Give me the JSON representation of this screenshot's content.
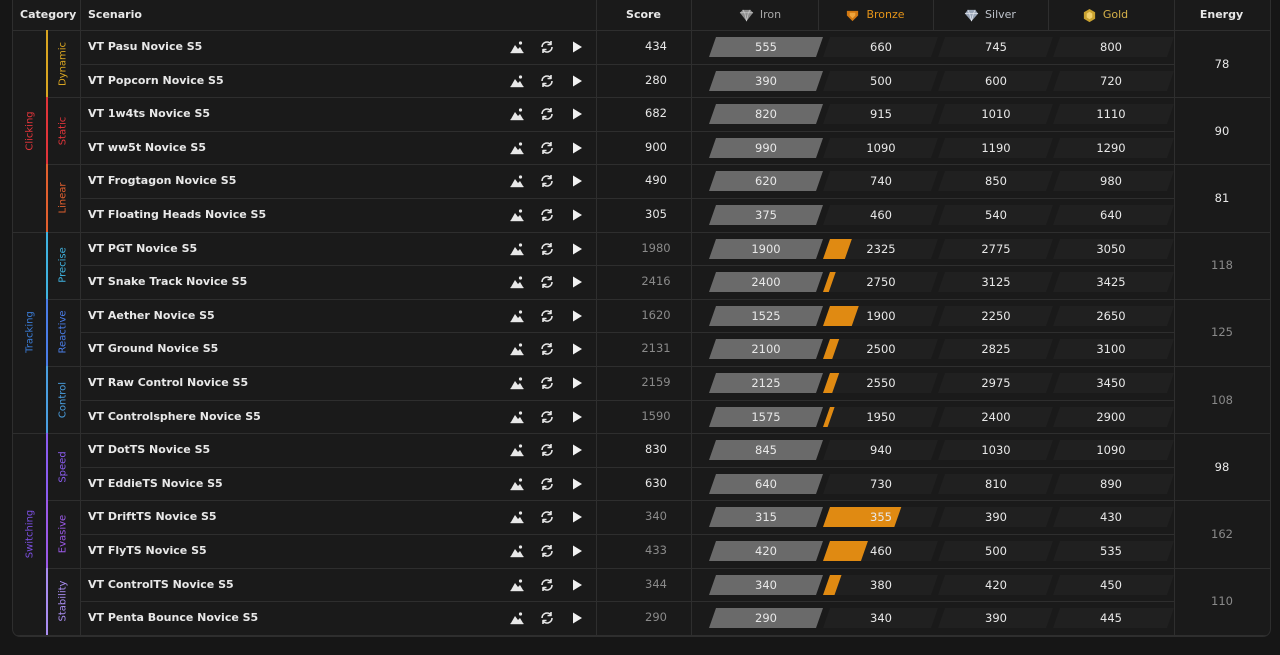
{
  "header": {
    "category": "Category",
    "scenario": "Scenario",
    "score": "Score",
    "iron": "Iron",
    "bronze": "Bronze",
    "silver": "Silver",
    "gold": "Gold",
    "energy": "Energy"
  },
  "colors": {
    "iron": "#a8a8a8",
    "bronze": "#e08a12",
    "silver": "#bfc4cc",
    "gold": "#d7b24a",
    "clicking": "#e0343a",
    "tracking": "#3a7bd5",
    "switching": "#7b4fe0"
  },
  "categories": [
    {
      "name": "Clicking",
      "color": "#e0343a",
      "rows": 6,
      "subs": [
        {
          "name": "Dynamic",
          "color": "#d9a521",
          "energy": "78",
          "energy_dim": false
        },
        {
          "name": "Static",
          "color": "#e0343a",
          "energy": "90",
          "energy_dim": false
        },
        {
          "name": "Linear",
          "color": "#e2602f",
          "energy": "81",
          "energy_dim": false
        }
      ]
    },
    {
      "name": "Tracking",
      "color": "#3a7bd5",
      "rows": 6,
      "subs": [
        {
          "name": "Precise",
          "color": "#3fb3e0",
          "energy": "118",
          "energy_dim": true
        },
        {
          "name": "Reactive",
          "color": "#4a7de8",
          "energy": "125",
          "energy_dim": true
        },
        {
          "name": "Control",
          "color": "#4a9fe0",
          "energy": "108",
          "energy_dim": true
        }
      ]
    },
    {
      "name": "Switching",
      "color": "#7b4fe0",
      "rows": 6,
      "subs": [
        {
          "name": "Speed",
          "color": "#8b5cf0",
          "energy": "98",
          "energy_dim": false
        },
        {
          "name": "Evasive",
          "color": "#9b59e8",
          "energy": "162",
          "energy_dim": true
        },
        {
          "name": "Stability",
          "color": "#a98df0",
          "energy": "110",
          "energy_dim": true
        }
      ]
    }
  ],
  "rows": [
    {
      "scenario": "VT Pasu Novice S5",
      "score": "434",
      "dim": false,
      "iron": "555",
      "bronze": "660",
      "silver": "745",
      "gold": "800",
      "progress": 0.0
    },
    {
      "scenario": "VT Popcorn Novice S5",
      "score": "280",
      "dim": false,
      "iron": "390",
      "bronze": "500",
      "silver": "600",
      "gold": "720",
      "progress": 0.0
    },
    {
      "scenario": "VT 1w4ts Novice S5",
      "score": "682",
      "dim": false,
      "iron": "820",
      "bronze": "915",
      "silver": "1010",
      "gold": "1110",
      "progress": 0.0
    },
    {
      "scenario": "VT ww5t Novice S5",
      "score": "900",
      "dim": false,
      "iron": "990",
      "bronze": "1090",
      "silver": "1190",
      "gold": "1290",
      "progress": 0.0
    },
    {
      "scenario": "VT Frogtagon Novice S5",
      "score": "490",
      "dim": false,
      "iron": "620",
      "bronze": "740",
      "silver": "850",
      "gold": "980",
      "progress": 0.0
    },
    {
      "scenario": "VT Floating Heads Novice S5",
      "score": "305",
      "dim": false,
      "iron": "375",
      "bronze": "460",
      "silver": "540",
      "gold": "640",
      "progress": 0.0
    },
    {
      "scenario": "VT PGT Novice S5",
      "score": "1980",
      "dim": true,
      "iron": "1900",
      "bronze": "2325",
      "silver": "2775",
      "gold": "3050",
      "progress": 0.19
    },
    {
      "scenario": "VT Snake Track Novice S5",
      "score": "2416",
      "dim": true,
      "iron": "2400",
      "bronze": "2750",
      "silver": "3125",
      "gold": "3425",
      "progress": 0.05
    },
    {
      "scenario": "VT Aether Novice S5",
      "score": "1620",
      "dim": true,
      "iron": "1525",
      "bronze": "1900",
      "silver": "2250",
      "gold": "2650",
      "progress": 0.25
    },
    {
      "scenario": "VT Ground Novice S5",
      "score": "2131",
      "dim": true,
      "iron": "2100",
      "bronze": "2500",
      "silver": "2825",
      "gold": "3100",
      "progress": 0.08
    },
    {
      "scenario": "VT Raw Control Novice S5",
      "score": "2159",
      "dim": true,
      "iron": "2125",
      "bronze": "2550",
      "silver": "2975",
      "gold": "3450",
      "progress": 0.08
    },
    {
      "scenario": "VT Controlsphere Novice S5",
      "score": "1590",
      "dim": true,
      "iron": "1575",
      "bronze": "1950",
      "silver": "2400",
      "gold": "2900",
      "progress": 0.04
    },
    {
      "scenario": "VT DotTS Novice S5",
      "score": "830",
      "dim": false,
      "iron": "845",
      "bronze": "940",
      "silver": "1030",
      "gold": "1090",
      "progress": 0.0
    },
    {
      "scenario": "VT EddieTS Novice S5",
      "score": "630",
      "dim": false,
      "iron": "640",
      "bronze": "730",
      "silver": "810",
      "gold": "890",
      "progress": 0.0
    },
    {
      "scenario": "VT DriftTS Novice S5",
      "score": "340",
      "dim": true,
      "iron": "315",
      "bronze": "355",
      "silver": "390",
      "gold": "430",
      "progress": 0.62
    },
    {
      "scenario": "VT FlyTS Novice S5",
      "score": "433",
      "dim": true,
      "iron": "420",
      "bronze": "460",
      "silver": "500",
      "gold": "535",
      "progress": 0.33
    },
    {
      "scenario": "VT ControlTS Novice S5",
      "score": "344",
      "dim": true,
      "iron": "340",
      "bronze": "380",
      "silver": "420",
      "gold": "450",
      "progress": 0.1
    },
    {
      "scenario": "VT Penta Bounce Novice S5",
      "score": "290",
      "dim": true,
      "iron": "290",
      "bronze": "340",
      "silver": "390",
      "gold": "445",
      "progress": 0.0
    }
  ]
}
